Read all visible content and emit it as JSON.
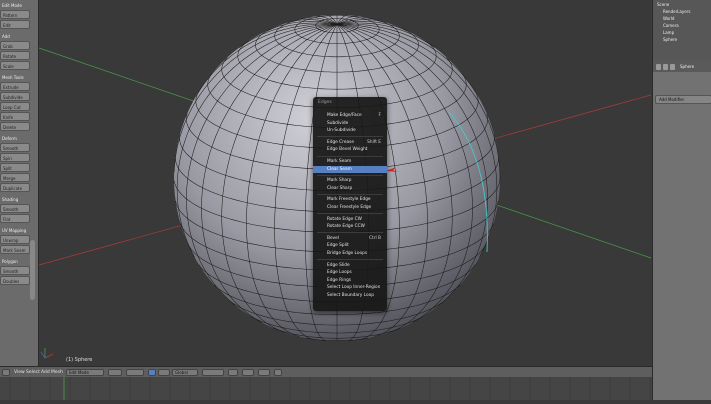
{
  "left_shelf": {
    "groups": [
      {
        "header": "Edit Mode",
        "buttons": [
          "Pattern",
          "Edit"
        ]
      },
      {
        "header": "Add",
        "buttons": [
          "Grab",
          "Rotate",
          "Scale"
        ]
      },
      {
        "header": "Mesh Tools",
        "buttons": [
          "Extrude",
          "Subdivide",
          "Loop Cut",
          "Knife",
          "Delete"
        ]
      },
      {
        "header": "Deform",
        "buttons": [
          "Smooth",
          "Spin",
          "Split",
          "Merge",
          "Duplicate"
        ]
      },
      {
        "header": "Shading",
        "buttons": [
          "Smooth",
          "Flat"
        ]
      },
      {
        "header": "UV Mapping",
        "buttons": [
          "Unwrap",
          "Mark Seam"
        ]
      },
      {
        "header": "Polygon",
        "buttons": [
          "Smooth",
          "Doubles"
        ]
      }
    ]
  },
  "outliner": {
    "rows": [
      "Scene",
      "RenderLayers",
      "World",
      "Camera",
      "Lamp",
      "Sphere"
    ]
  },
  "properties": {
    "object_name": "Sphere",
    "modifier_label": "Add Modifier"
  },
  "viewport": {
    "info_text": "(1) Sphere"
  },
  "header": {
    "view": "View",
    "select": "Select",
    "add": "Add",
    "mesh": "Mesh",
    "mode": "Edit Mode",
    "pivot": "Global"
  },
  "context_menu": {
    "title": "Edges",
    "items": [
      {
        "label": "Make Edge/Face",
        "shortcut": "F"
      },
      {
        "label": "Subdivide",
        "shortcut": ""
      },
      {
        "label": "Un-Subdivide",
        "shortcut": ""
      },
      {
        "label": "Edge Crease",
        "shortcut": "Shift E"
      },
      {
        "label": "Edge Bevel Weight",
        "shortcut": ""
      },
      {
        "label": "Mark Seam",
        "shortcut": ""
      },
      {
        "label": "Clear Seam",
        "shortcut": ""
      },
      {
        "label": "Mark Sharp",
        "shortcut": ""
      },
      {
        "label": "Clear Sharp",
        "shortcut": ""
      },
      {
        "label": "Mark Freestyle Edge",
        "shortcut": ""
      },
      {
        "label": "Clear Freestyle Edge",
        "shortcut": ""
      },
      {
        "label": "Rotate Edge CW",
        "shortcut": ""
      },
      {
        "label": "Rotate Edge CCW",
        "shortcut": ""
      },
      {
        "label": "Bevel",
        "shortcut": "Ctrl B"
      },
      {
        "label": "Edge Split",
        "shortcut": ""
      },
      {
        "label": "Bridge Edge Loops",
        "shortcut": ""
      },
      {
        "label": "Edge Slide",
        "shortcut": ""
      },
      {
        "label": "Edge Loops",
        "shortcut": ""
      },
      {
        "label": "Edge Rings",
        "shortcut": ""
      },
      {
        "label": "Select Loop Inner-Region",
        "shortcut": ""
      },
      {
        "label": "Select Boundary Loop",
        "shortcut": ""
      }
    ],
    "highlighted_index": 6
  },
  "colors": {
    "menu_highlight": "#5680c2",
    "sphere_light": "#c2c2cc",
    "sphere_dark": "#4a4a52",
    "wire": "#1c1c1c",
    "x_axis": "#b13b3b",
    "y_axis": "#4c9a4c",
    "selected_edge": "#46c8c8"
  }
}
